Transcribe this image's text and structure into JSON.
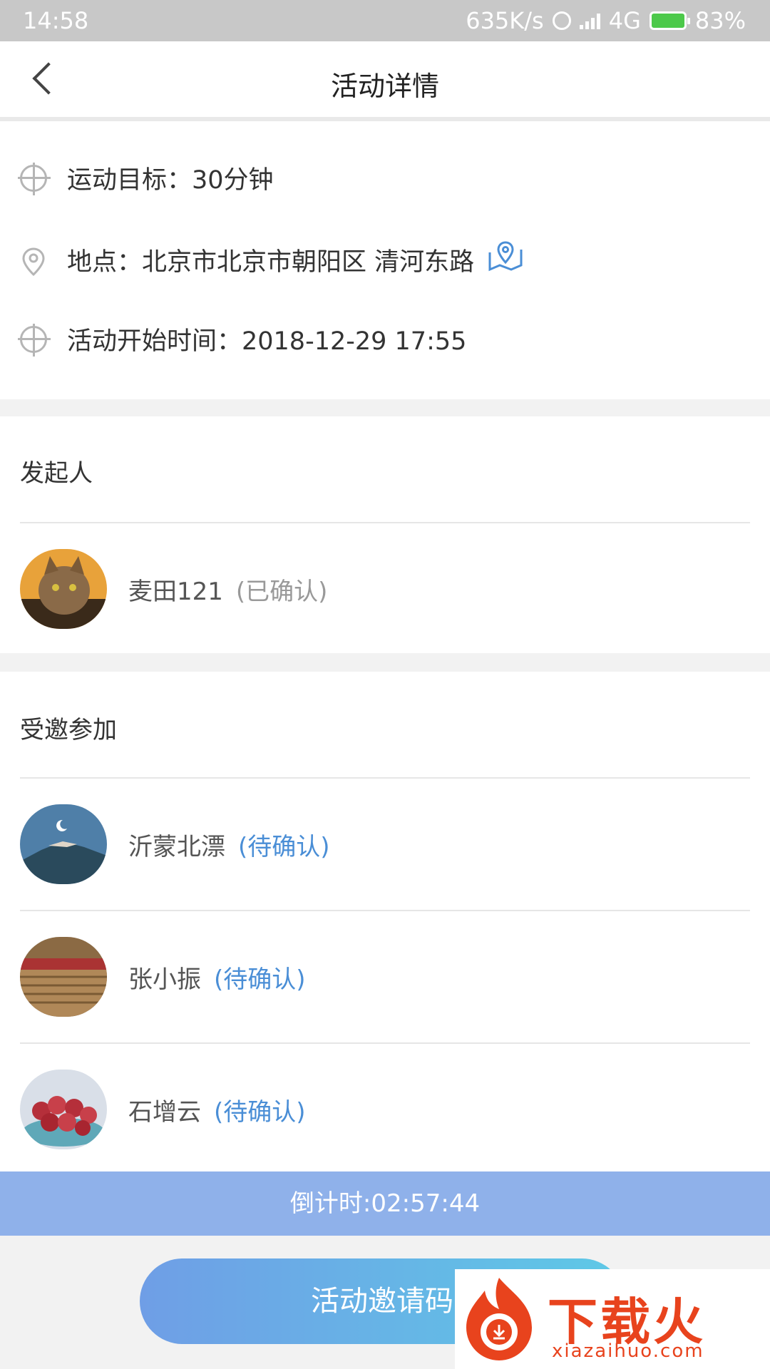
{
  "status_bar": {
    "time": "14:58",
    "speed": "635K/s",
    "network": "4G",
    "battery": "83%"
  },
  "header": {
    "title": "活动详情"
  },
  "info": {
    "goal": "运动目标：30分钟",
    "location": "地点：北京市北京市朝阳区 清河东路",
    "start_time": "活动开始时间：2018-12-29 17:55"
  },
  "initiator": {
    "title": "发起人",
    "name": "麦田121",
    "status": "(已确认)"
  },
  "invited": {
    "title": "受邀参加",
    "people": [
      {
        "name": "沂蒙北漂",
        "status": "(待确认)"
      },
      {
        "name": "张小振",
        "status": "(待确认)"
      },
      {
        "name": "石增云",
        "status": "(待确认)"
      }
    ]
  },
  "countdown": "倒计时:02:57:44",
  "invite_button": "活动邀请码",
  "watermark": {
    "brand": "下载火",
    "url": "xiazaihuo.com"
  },
  "colors": {
    "accent_blue": "#4a8ed6",
    "countdown_bg": "#8fb1ea",
    "watermark": "#e8431d"
  }
}
